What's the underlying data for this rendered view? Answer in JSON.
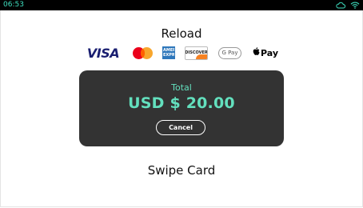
{
  "status_bar": {
    "time": "06:53",
    "icons": [
      "cloud-icon",
      "wifi-icon"
    ],
    "accent_color": "#3fe0c0"
  },
  "screen": {
    "title": "Reload",
    "payment_methods": [
      {
        "name": "visa-logo",
        "text": "VISA"
      },
      {
        "name": "mastercard-logo",
        "text": ""
      },
      {
        "name": "amex-logo",
        "text": "AMERICAN EXPRESS"
      },
      {
        "name": "discover-logo",
        "text": "DISCOVER"
      },
      {
        "name": "google-pay-logo",
        "text": "G Pay"
      },
      {
        "name": "apple-pay-logo",
        "text": "Pay"
      }
    ],
    "total_label": "Total",
    "total_amount": "USD $ 20.00",
    "cancel_label": "Cancel",
    "instruction": "Swipe Card"
  },
  "colors": {
    "panel_bg": "#333333",
    "total_text": "#63e0be"
  }
}
